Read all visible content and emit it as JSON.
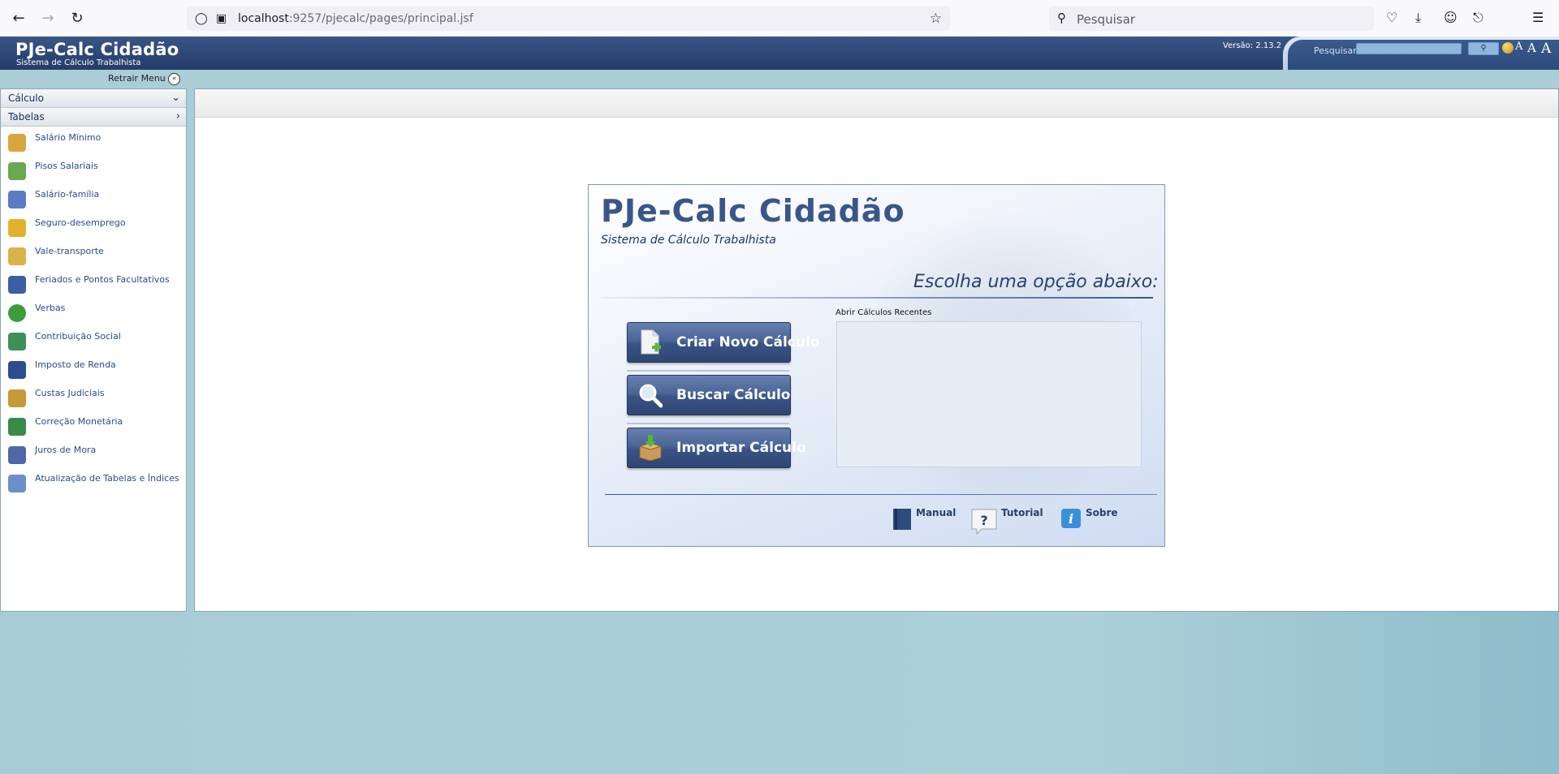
{
  "browser": {
    "url_host": "localhost",
    "url_path": ":9257/pjecalc/pages/principal.jsf",
    "search_placeholder": "Pesquisar"
  },
  "header": {
    "app_title": "PJe-Calc Cidadão",
    "app_subtitle": "Sistema de Cálculo Trabalhista",
    "version": "Versão: 2.13.2",
    "search_label": "Pesquisar",
    "font_buttons": [
      "A",
      "A",
      "A"
    ]
  },
  "menu": {
    "retract_label": "Retrair Menu",
    "sections": [
      {
        "label": "Cálculo",
        "chevron": "⌄"
      },
      {
        "label": "Tabelas",
        "chevron": "›"
      }
    ],
    "items": [
      {
        "label": "Salário Mínimo",
        "icon": "money-bag-icon",
        "color": "#d8a63c"
      },
      {
        "label": "Pisos Salariais",
        "icon": "people-money-icon",
        "color": "#6aa94f"
      },
      {
        "label": "Salário-família",
        "icon": "family-icon",
        "color": "#5b7cc4"
      },
      {
        "label": "Seguro-desemprego",
        "icon": "worker-icon",
        "color": "#e3b12e"
      },
      {
        "label": "Vale-transporte",
        "icon": "ticket-icon",
        "color": "#d9b24a"
      },
      {
        "label": "Feriados e Pontos Facultativos",
        "icon": "calendar-icon",
        "color": "#3c5fa3"
      },
      {
        "label": "Verbas",
        "icon": "dollar-coin-icon",
        "color": "#3c9b3a"
      },
      {
        "label": "Contribuição Social",
        "icon": "contribution-icon",
        "color": "#3f8e5a"
      },
      {
        "label": "Imposto de Renda",
        "icon": "tax-icon",
        "color": "#2d4c92"
      },
      {
        "label": "Custas Judiciais",
        "icon": "scales-icon",
        "color": "#c69a3a"
      },
      {
        "label": "Correção Monetária",
        "icon": "chart-up-icon",
        "color": "#3a8a4a"
      },
      {
        "label": "Juros de Mora",
        "icon": "interest-icon",
        "color": "#5166a6"
      },
      {
        "label": "Atualização de Tabelas e Índices",
        "icon": "table-update-icon",
        "color": "#6b8fc8"
      }
    ]
  },
  "card": {
    "title": "PJe-Calc Cidadão",
    "subtitle": "Sistema de Cálculo Trabalhista",
    "choose_option": "Escolha uma opção abaixo:",
    "buttons": [
      {
        "label": "Criar Novo Cálculo",
        "icon": "new-document-icon"
      },
      {
        "label": "Buscar Cálculo",
        "icon": "magnifier-icon"
      },
      {
        "label": "Importar Cálculo",
        "icon": "import-box-icon"
      }
    ],
    "recent_label": "Abrir Cálculos Recentes",
    "footer_links": [
      {
        "label": "Manual",
        "icon": "book-icon"
      },
      {
        "label": "Tutorial",
        "icon": "question-icon"
      },
      {
        "label": "Sobre",
        "icon": "info-icon"
      }
    ]
  }
}
